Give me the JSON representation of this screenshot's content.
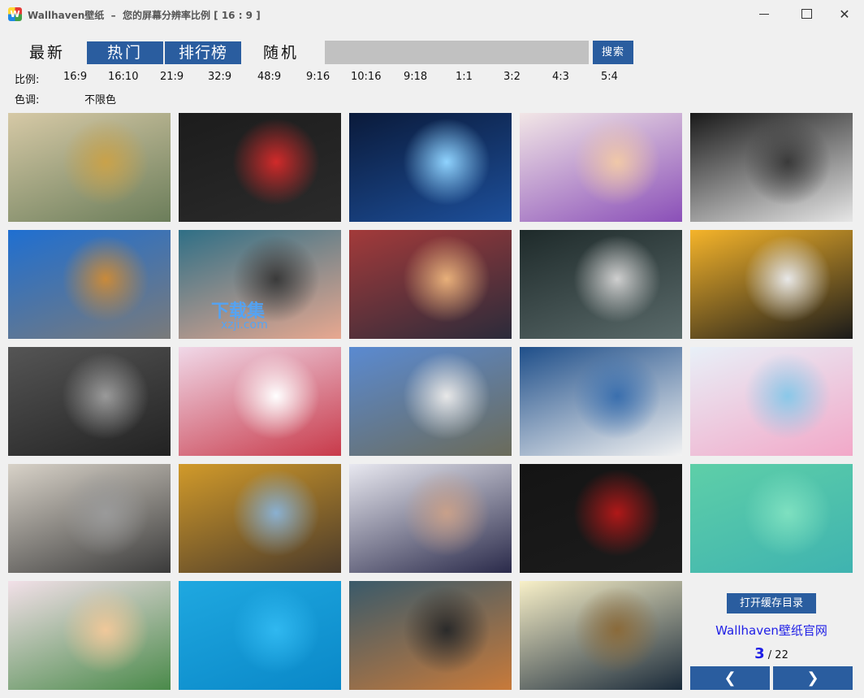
{
  "window": {
    "app_icon_letter": "W",
    "title": "Wallhaven壁纸  –  您的屏幕分辨率比例 [ 16 : 9 ]",
    "close_glyph": "✕"
  },
  "nav": {
    "latest": "最新",
    "hot": "热门",
    "toplist": "排行榜",
    "random": "随机"
  },
  "search": {
    "value": "",
    "button": "搜索"
  },
  "filters": {
    "ratio_label": "比例:",
    "ratios": [
      "16:9",
      "16:10",
      "21:9",
      "32:9",
      "48:9",
      "9:16",
      "10:16",
      "9:18",
      "1:1",
      "3:2",
      "4:3",
      "5:4"
    ],
    "color_label": "色调:",
    "color_value": "不限色"
  },
  "thumbnails": [
    {
      "name": "fantasy-castle",
      "c1": "#d6c9a6",
      "c2": "#6b7d5a",
      "c3": "#c9a24a"
    },
    {
      "name": "sith-lightsaber",
      "c1": "#1c1c1c",
      "c2": "#2b2b2b",
      "c3": "#d12a2a"
    },
    {
      "name": "blue-deer",
      "c1": "#0a1a3a",
      "c2": "#1d4f9a",
      "c3": "#8fd3ff"
    },
    {
      "name": "anime-purple-girl",
      "c1": "#f2e6e6",
      "c2": "#8a4fb8",
      "c3": "#f0c8a8"
    },
    {
      "name": "anime-white-hair",
      "c1": "#1a1a1a",
      "c2": "#e6e6e6",
      "c3": "#3a3a3a"
    },
    {
      "name": "airplane-runway",
      "c1": "#1f6fd1",
      "c2": "#7a7a7a",
      "c3": "#c98a3a"
    },
    {
      "name": "flying-creature",
      "c1": "#2f6f86",
      "c2": "#e8a890",
      "c3": "#3a3a3a"
    },
    {
      "name": "mountain-reflection",
      "c1": "#a33a3a",
      "c2": "#2b2b3a",
      "c3": "#e8b07a"
    },
    {
      "name": "witcher",
      "c1": "#1e2a2a",
      "c2": "#5a6a6a",
      "c3": "#cfcfcf"
    },
    {
      "name": "anime-devil-girl",
      "c1": "#f5b42a",
      "c2": "#1a1a1a",
      "c3": "#e8e8e8"
    },
    {
      "name": "street-cat",
      "c1": "#555555",
      "c2": "#222222",
      "c3": "#9a9a9a"
    },
    {
      "name": "anime-sports-girl",
      "c1": "#f0d8e8",
      "c2": "#c83a4a",
      "c3": "#ffffff"
    },
    {
      "name": "snow-mountain-lake",
      "c1": "#5a8ad1",
      "c2": "#6b6b5a",
      "c3": "#e8e8e8"
    },
    {
      "name": "wave-pattern",
      "c1": "#1f4f8a",
      "c2": "#f2f2f2",
      "c3": "#3a6fae"
    },
    {
      "name": "anime-colorful-crowd",
      "c1": "#e8f0f8",
      "c2": "#f2a8c8",
      "c3": "#8ac8e8"
    },
    {
      "name": "bw-portrait",
      "c1": "#d8d2c8",
      "c2": "#3a3a3a",
      "c3": "#9a9a9a"
    },
    {
      "name": "autumn-temple",
      "c1": "#d19a2a",
      "c2": "#4a3a2a",
      "c3": "#8ab0d1"
    },
    {
      "name": "anime-school-uniform",
      "c1": "#e8e8f0",
      "c2": "#2a2a4a",
      "c3": "#c8a08a"
    },
    {
      "name": "dark-minimal",
      "c1": "#141414",
      "c2": "#1c1c1c",
      "c3": "#b01818"
    },
    {
      "name": "teal-gradient",
      "c1": "#5ecfa8",
      "c2": "#3fb3b0",
      "c3": "#7ee0c0"
    },
    {
      "name": "anime-elf-trio",
      "c1": "#f2e0e8",
      "c2": "#4a8a4a",
      "c3": "#f0c89a"
    },
    {
      "name": "blue-gradient",
      "c1": "#1fa8e0",
      "c2": "#0a88c8",
      "c3": "#30b8f0"
    },
    {
      "name": "girl-headphones",
      "c1": "#3a5a6a",
      "c2": "#c87a3a",
      "c3": "#2a2a2a"
    },
    {
      "name": "space-ship-planet",
      "c1": "#f8f0c8",
      "c2": "#1a2a3a",
      "c3": "#8a6a3a"
    }
  ],
  "watermark": {
    "line1": "下载集",
    "line2": "xzji.com"
  },
  "side_panel": {
    "open_cache": "打开缓存目录",
    "official_site": "Wallhaven壁纸官网",
    "current_page": "3",
    "total_pages": "/ 22",
    "prev_glyph": "❮",
    "next_glyph": "❯"
  },
  "colors": {
    "accent": "#2a5d9f",
    "link": "#1e1ee6",
    "background": "#f0f0f0"
  }
}
